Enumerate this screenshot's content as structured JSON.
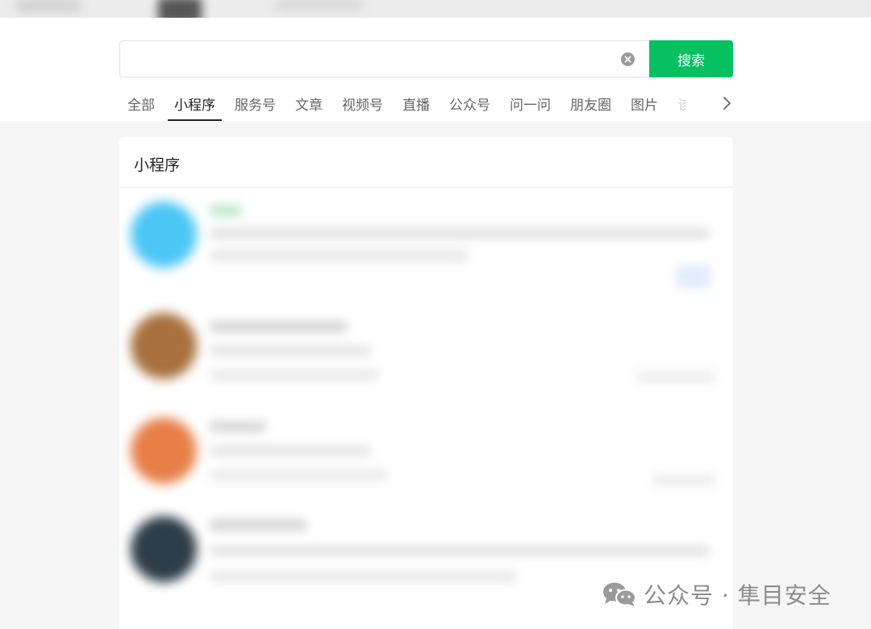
{
  "search": {
    "value": "",
    "placeholder": "",
    "button_label": "搜索"
  },
  "tabs": [
    {
      "label": "全部",
      "active": false
    },
    {
      "label": "小程序",
      "active": true
    },
    {
      "label": "服务号",
      "active": false
    },
    {
      "label": "文章",
      "active": false
    },
    {
      "label": "视频号",
      "active": false
    },
    {
      "label": "直播",
      "active": false
    },
    {
      "label": "公众号",
      "active": false
    },
    {
      "label": "问一问",
      "active": false
    },
    {
      "label": "朋友圈",
      "active": false
    },
    {
      "label": "图片",
      "active": false
    },
    {
      "label": "该",
      "active": false
    }
  ],
  "results_section": {
    "title": "小程序"
  },
  "watermark": {
    "text": "公众号 · 隼目安全"
  },
  "colors": {
    "accent": "#07c160",
    "background": "#f5f5f5",
    "card": "#ffffff",
    "muted_text": "#8c8c8c"
  },
  "icons": {
    "clear": "clear-icon",
    "next": "chevron-right-icon",
    "brand": "wechat-icon"
  }
}
